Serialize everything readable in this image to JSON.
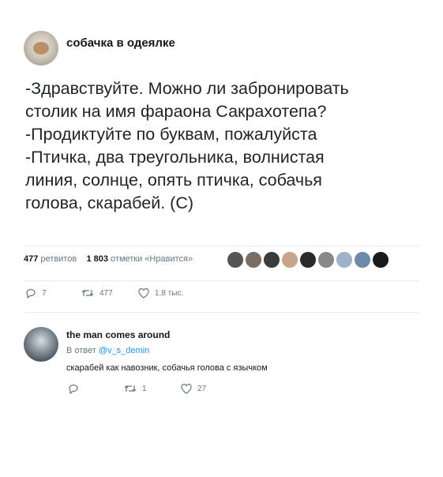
{
  "tweet": {
    "display_name": "собачка в одеялке",
    "lines": [
      "-Здравствуйте. Можно ли забронировать",
      "столик на имя фараона Сакрахотепа?",
      "-Продиктуйте по буквам, пожалуйста",
      "-Птичка, два треугольника, волнистая",
      "линия, солнце, опять птичка, собачья",
      "голова, скарабей. (С)"
    ],
    "stats": {
      "retweets_count": "477",
      "retweets_label": "ретвитов",
      "likes_count": "1 803",
      "likes_label": "отметки «Нравится»"
    },
    "actions": {
      "replies": "7",
      "retweets": "477",
      "likes": "1,8 тыс."
    }
  },
  "reply": {
    "display_name": "the man comes around",
    "reply_prefix": "В ответ",
    "reply_handle": "@v_s_demin",
    "text": "скарабей как навозник, собачья голова с язычком",
    "actions": {
      "replies": "",
      "retweets": "1",
      "likes": "27"
    }
  },
  "icons": {
    "reply": "reply-icon",
    "retweet": "retweet-icon",
    "like": "heart-icon"
  },
  "colors": {
    "text": "#14171a",
    "muted": "#657786",
    "link": "#1b95e0",
    "divider": "#e6ecf0"
  }
}
